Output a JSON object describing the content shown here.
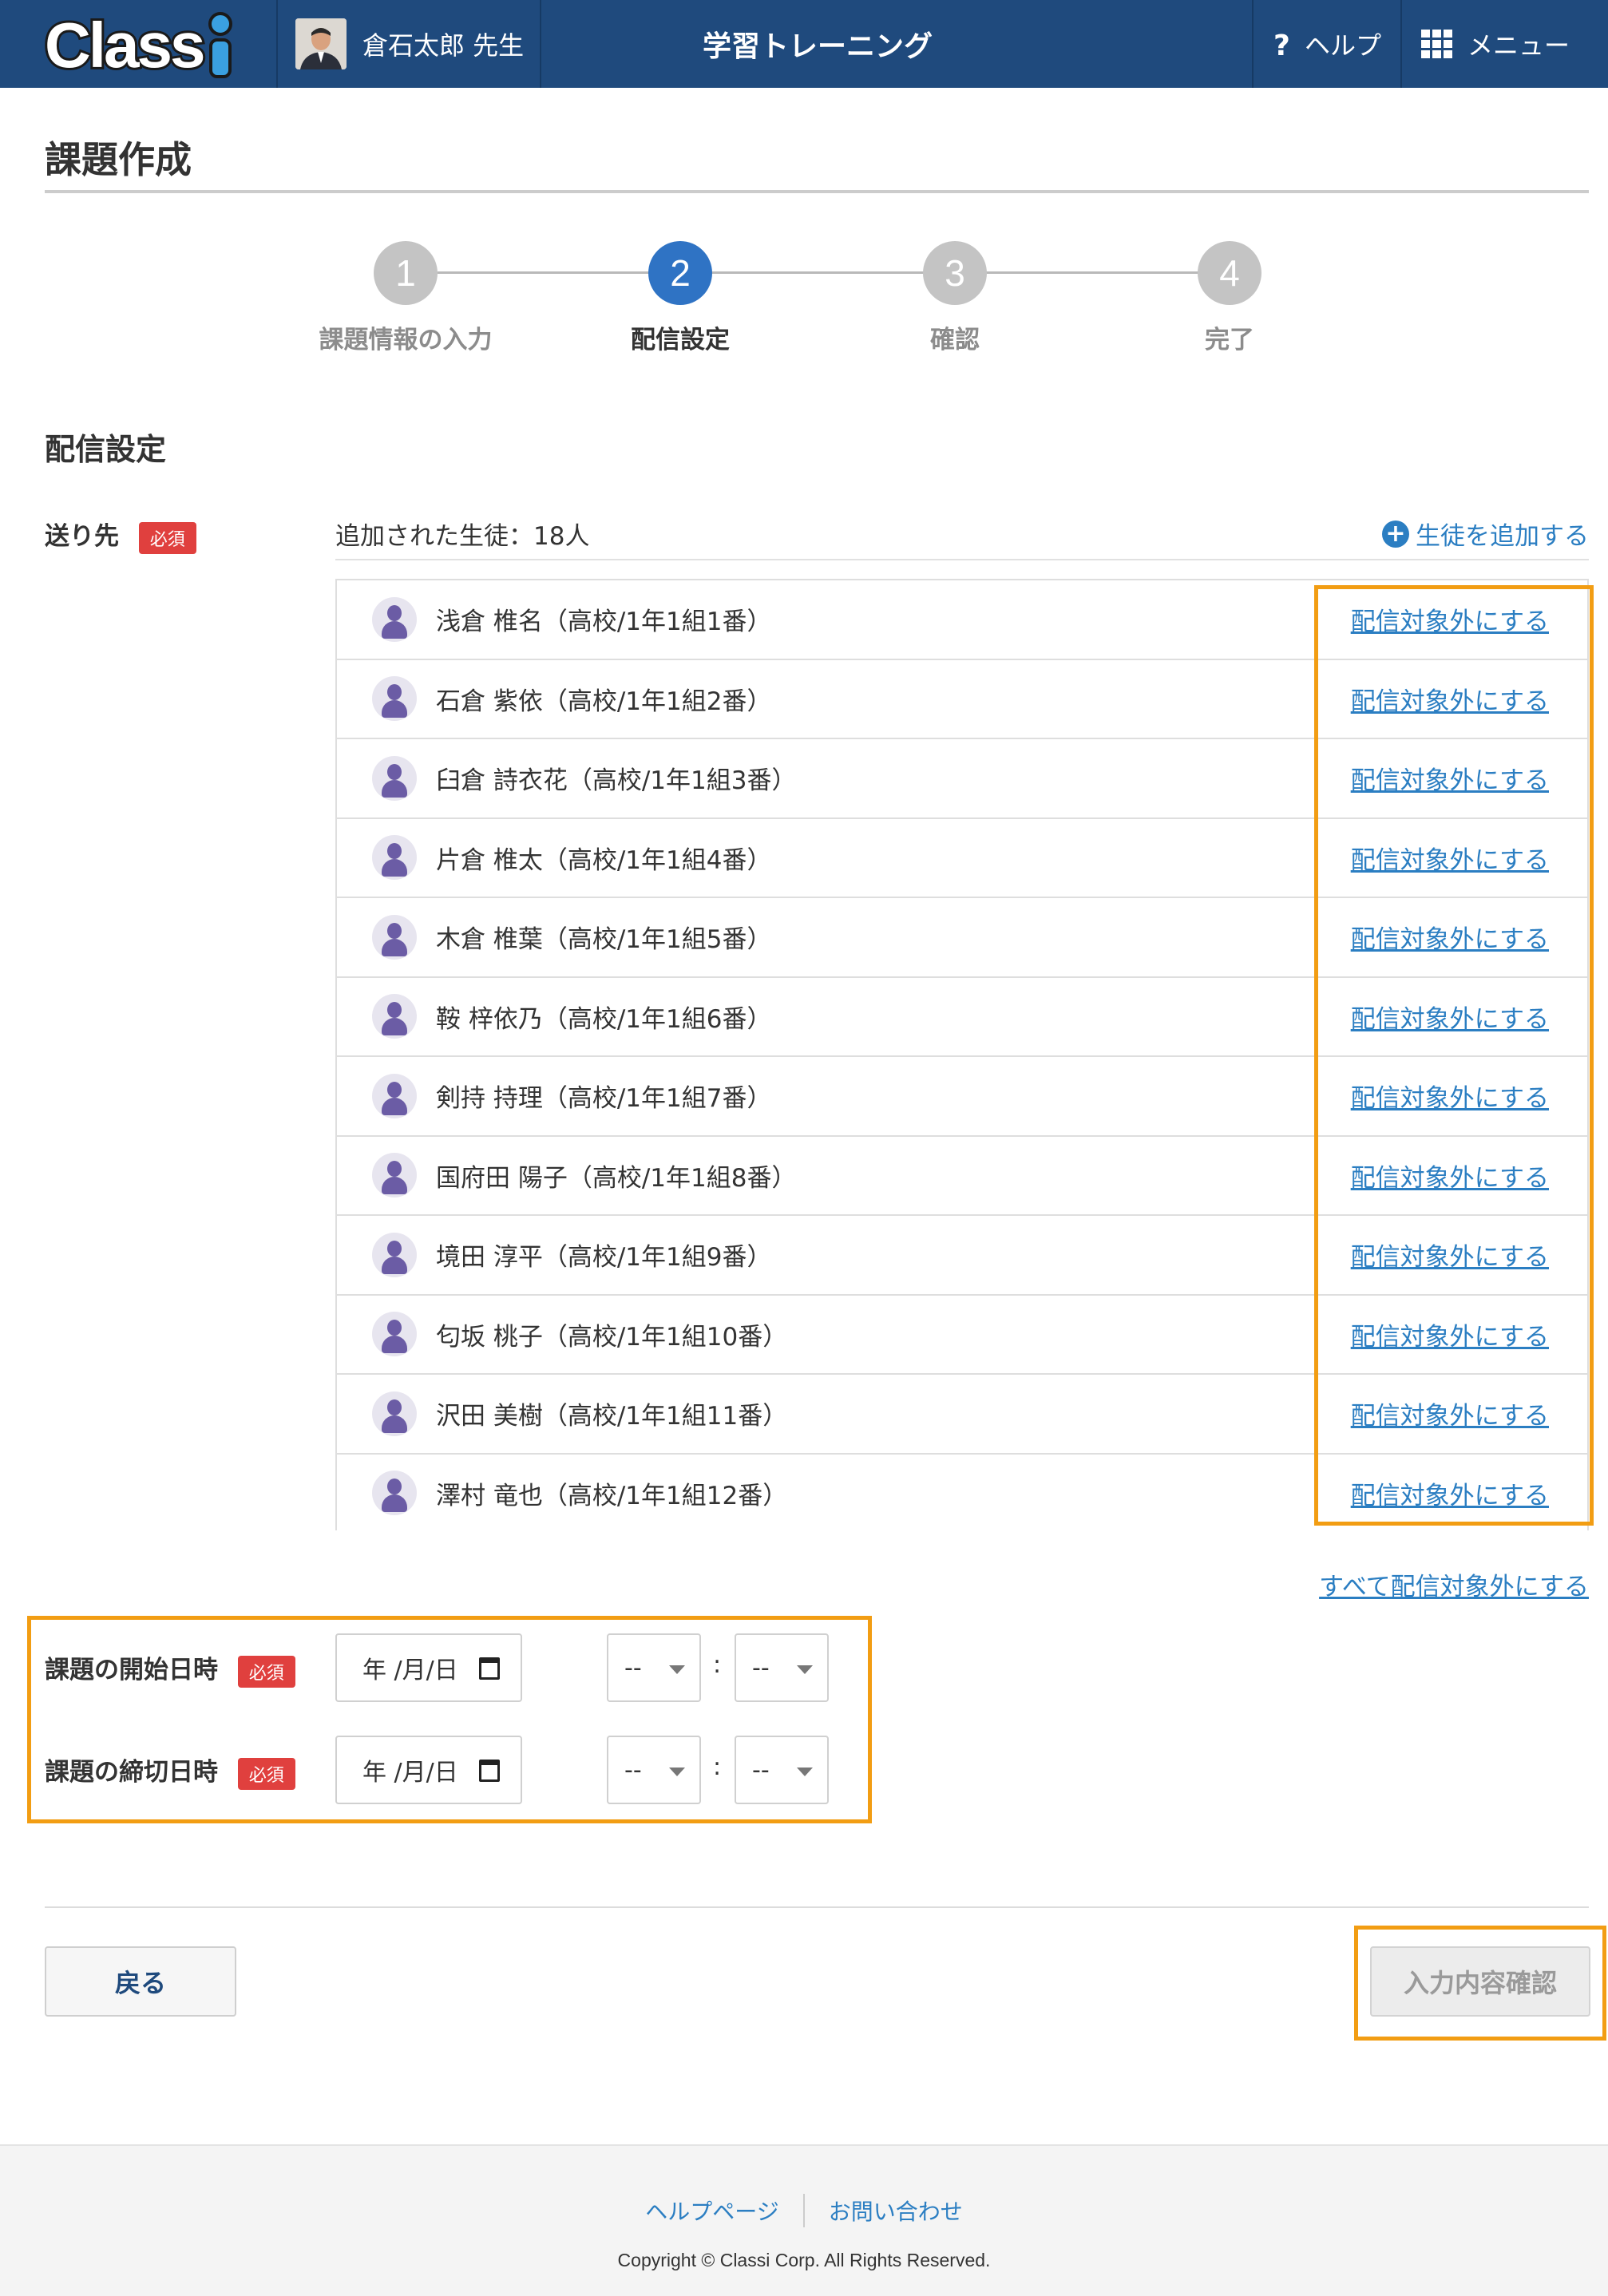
{
  "header": {
    "logo_text": "Classi",
    "user_name": "倉石太郎 先生",
    "app_title": "学習トレーニング",
    "help_label": "ヘルプ",
    "menu_label": "メニュー"
  },
  "page": {
    "title": "課題作成"
  },
  "stepper": {
    "current_step": 2,
    "steps": [
      {
        "number": "1",
        "label": "課題情報の入力"
      },
      {
        "number": "2",
        "label": "配信設定"
      },
      {
        "number": "3",
        "label": "確認"
      },
      {
        "number": "4",
        "label": "完了"
      }
    ]
  },
  "delivery": {
    "section_title": "配信設定",
    "recipients_label": "送り先",
    "required_badge": "必須",
    "added_count": "追加された生徒：18人",
    "add_student_label": "生徒を追加する",
    "plus_glyph": "+",
    "exclude_label": "配信対象外にする",
    "exclude_all_label": "すべて配信対象外にする",
    "students": [
      {
        "name": "浅倉 椎名（高校/1年1組1番）"
      },
      {
        "name": "石倉 紫依（高校/1年1組2番）"
      },
      {
        "name": "臼倉 詩衣花（高校/1年1組3番）"
      },
      {
        "name": "片倉 椎太（高校/1年1組4番）"
      },
      {
        "name": "木倉 椎葉（高校/1年1組5番）"
      },
      {
        "name": "鞍 梓依乃（高校/1年1組6番）"
      },
      {
        "name": "剣持 持理（高校/1年1組7番）"
      },
      {
        "name": "国府田 陽子（高校/1年1組8番）"
      },
      {
        "name": "境田 淳平（高校/1年1組9番）"
      },
      {
        "name": "匂坂 桃子（高校/1年1組10番）"
      },
      {
        "name": "沢田 美樹（高校/1年1組11番）"
      },
      {
        "name": "澤村 竜也（高校/1年1組12番）"
      }
    ]
  },
  "schedule": {
    "start_label": "課題の開始日時",
    "end_label": "課題の締切日時",
    "required_badge": "必須",
    "date_placeholder": "年 /月/日",
    "hour_value": "--",
    "minute_value": "--",
    "colon": ":"
  },
  "actions": {
    "back_label": "戻る",
    "confirm_label": "入力内容確認"
  },
  "footer": {
    "help_page": "ヘルプページ",
    "contact": "お問い合わせ",
    "copyright": "Copyright © Classi Corp. All Rights Reserved."
  },
  "colors": {
    "header_bg": "#1f4a7d",
    "accent_blue": "#2f73c4",
    "link_blue": "#2b7ec2",
    "required_red": "#e0403e",
    "highlight_orange": "#f29d13"
  },
  "icons": {
    "help": "question-mark-icon",
    "menu": "grid-icon",
    "add": "plus-circle-icon",
    "student": "person-icon",
    "calendar": "calendar-icon",
    "dropdown": "caret-down-icon"
  }
}
